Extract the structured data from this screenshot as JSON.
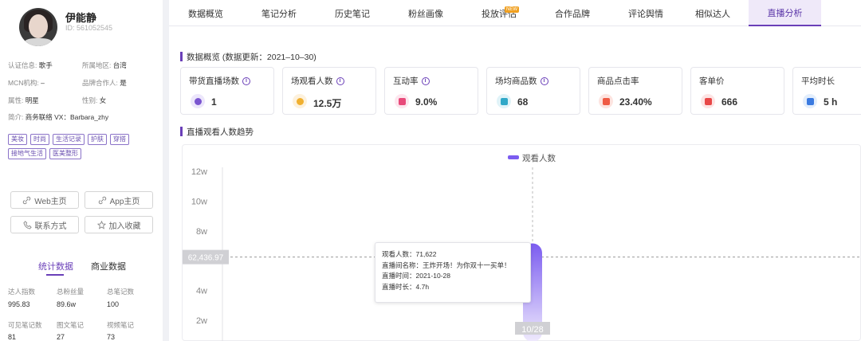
{
  "profile": {
    "name": "伊能静",
    "id_text": "ID: 561052545",
    "fields": [
      {
        "k": "认证信息:",
        "v": "歌手"
      },
      {
        "k": "所属地区:",
        "v": "台湾"
      },
      {
        "k": "MCN机构:",
        "v": "–"
      },
      {
        "k": "品牌合作人:",
        "v": "是"
      },
      {
        "k": "属性:",
        "v": "明星"
      },
      {
        "k": "性别:",
        "v": "女"
      },
      {
        "k": "简介:",
        "v": "商务联络 VX：Barbara_zhy"
      }
    ],
    "tags": [
      "美妆",
      "时尚",
      "生活记录",
      "护肤",
      "穿搭",
      "接地气生活",
      "医美整形"
    ],
    "buttons": {
      "web": "Web主页",
      "app": "App主页",
      "contact": "联系方式",
      "favorite": "加入收藏"
    },
    "tabs": {
      "stats": "统计数据",
      "business": "商业数据"
    },
    "stats": [
      {
        "label": "达人指数",
        "value": "995.83"
      },
      {
        "label": "总粉丝量",
        "value": "89.6w"
      },
      {
        "label": "总笔记数",
        "value": "100"
      },
      {
        "label": "可见笔记数",
        "value": "81"
      },
      {
        "label": "图文笔记",
        "value": "27"
      },
      {
        "label": "视频笔记",
        "value": "73"
      }
    ]
  },
  "nav": {
    "items": [
      "数据概览",
      "笔记分析",
      "历史笔记",
      "粉丝画像",
      "投放评估",
      "合作品牌",
      "评论舆情",
      "相似达人",
      "直播分析"
    ],
    "new_badge": "NEW",
    "active": "直播分析"
  },
  "overview": {
    "title": "数据概览 (数据更新：2021–10–30)",
    "cards": [
      {
        "label": "带货直播场数",
        "value": "1",
        "info": true,
        "icon_color": "#ece6fb",
        "icon_fg": "#7a55d0",
        "icon": "person-icon"
      },
      {
        "label": "场观看人数",
        "value": "12.5万",
        "info": true,
        "icon_color": "#fdf1dc",
        "icon_fg": "#f0b030",
        "icon": "viewer-icon"
      },
      {
        "label": "互动率",
        "value": "9.0%",
        "info": true,
        "icon_color": "#fde6ee",
        "icon_fg": "#e84a7a",
        "icon": "interaction-icon"
      },
      {
        "label": "场均商品数",
        "value": "68",
        "info": true,
        "icon_color": "#e0f3f8",
        "icon_fg": "#30a8c8",
        "icon": "thumb-icon"
      },
      {
        "label": "商品点击率",
        "value": "23.40%",
        "info": false,
        "icon_color": "#fde4e0",
        "icon_fg": "#ef5b45",
        "icon": "click-icon"
      },
      {
        "label": "客单价",
        "value": "666",
        "info": false,
        "icon_color": "#fde4e4",
        "icon_fg": "#e84848",
        "icon": "price-icon"
      },
      {
        "label": "平均时长",
        "value": "5 h",
        "info": false,
        "icon_color": "#e3eefc",
        "icon_fg": "#3a7ae0",
        "icon": "duration-icon"
      }
    ]
  },
  "trend": {
    "title": "直播观看人数趋势"
  },
  "chart_data": {
    "type": "bar",
    "categories": [
      "10/28"
    ],
    "series": [
      {
        "name": "观看人数",
        "values": [
          71622
        ]
      }
    ],
    "yticks": [
      "2w",
      "4w",
      "6w",
      "8w",
      "10w",
      "12w"
    ],
    "ylim": [
      20000,
      120000
    ],
    "crosshair_label": "62,436.97",
    "crosshair_value": 62436.97,
    "bar_color_top": "#7b5cf0",
    "bar_color_bottom": "#efeafd"
  },
  "tooltip": {
    "lines": [
      "观看人数：71,622",
      "直播间名称：王炸开场！为你双十一买单！",
      "直播时间：2021-10-28",
      "直播时长：4.7h"
    ]
  }
}
